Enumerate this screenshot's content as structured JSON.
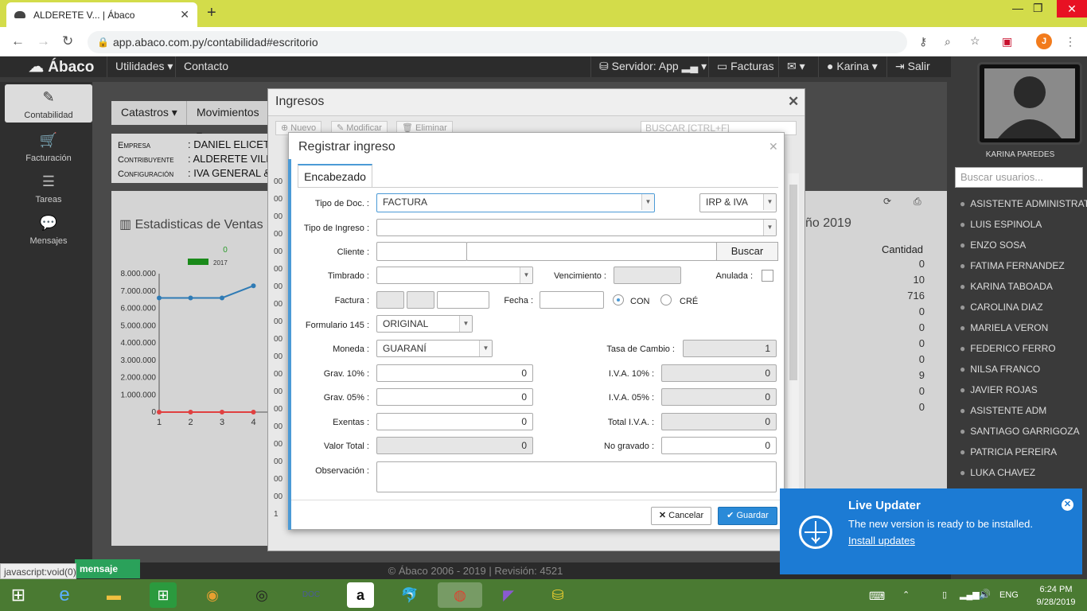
{
  "browser": {
    "tab_title": "ALDERETE V... | Ábaco",
    "url": "app.abaco.com.py/contabilidad#escritorio",
    "profile_initial": "J"
  },
  "app": {
    "brand": "Ábaco",
    "topnav": {
      "utilidades": "Utilidades",
      "contacto": "Contacto",
      "servidor": "Servidor: App",
      "facturas": "Facturas",
      "user": "Karina",
      "salir": "Salir"
    },
    "sidebar": [
      {
        "label": "Contabilidad",
        "icon": "paperclip-icon"
      },
      {
        "label": "Facturación",
        "icon": "cart-icon"
      },
      {
        "label": "Tareas",
        "icon": "tasks-icon"
      },
      {
        "label": "Mensajes",
        "icon": "comments-icon"
      }
    ],
    "menubar": {
      "catastros": "Catastros",
      "movimientos": "Movimientos"
    },
    "info": [
      {
        "key": "Empresa",
        "value": ": DANIEL ELICET"
      },
      {
        "key": "Contribuyente",
        "value": ": ALDERETE VILL"
      },
      {
        "key": "Configuración",
        "value": ": IVA GENERAL &"
      }
    ],
    "stats": {
      "title": "Estadisticas de Ventas",
      "title_right": "ño 2019",
      "legend_value": "0",
      "legend_year": "2017",
      "col_header": "Cantidad",
      "quantities": [
        "0",
        "10",
        "716",
        "0",
        "0",
        "0",
        "0",
        "9",
        "0",
        "0"
      ]
    },
    "footer": "© Ábaco 2006 - 2019 | Revisión: 4521",
    "status_url": "javascript:void(0)",
    "message_button": "mensaje"
  },
  "chart_data": {
    "type": "line",
    "title": "",
    "xlabel": "",
    "ylabel": "",
    "ylim": [
      0,
      8000000
    ],
    "x": [
      1,
      2,
      3,
      4
    ],
    "yticks": [
      "8.000.000",
      "7.000.000",
      "6.000.000",
      "5.000.000",
      "4.000.000",
      "3.000.000",
      "2.000.000",
      "1.000.000",
      "0"
    ],
    "series": [
      {
        "name": "2017",
        "color": "#2f7bb5",
        "values": [
          6600000,
          6600000,
          6600000,
          7300000
        ]
      },
      {
        "name": "",
        "color": "#e04040",
        "values": [
          0,
          0,
          0,
          0
        ]
      }
    ]
  },
  "users": {
    "current": "KARINA PAREDES",
    "search_placeholder": "Buscar usuarios...",
    "list": [
      "ASISTENTE ADMINISTRAT...",
      "LUIS ESPINOLA",
      "ENZO SOSA",
      "FATIMA FERNANDEZ",
      "KARINA TABOADA",
      "CAROLINA DIAZ",
      "MARIELA VERON",
      "FEDERICO FERRO",
      "NILSA FRANCO",
      "JAVIER ROJAS",
      "ASISTENTE ADM",
      "SANTIAGO GARRIGOZA",
      "PATRICIA PEREIRA",
      "LUKA CHAVEZ"
    ]
  },
  "ingresos": {
    "title": "Ingresos",
    "nuevo": "Nuevo",
    "modificar": "Modificar",
    "eliminar": "Eliminar",
    "search_placeholder": "BUSCAR [CTRL+F]",
    "rows": [
      "00",
      "00",
      "00",
      "00",
      "00",
      "00",
      "00",
      "00",
      "00",
      "00",
      "00",
      "00",
      "00",
      "00",
      "00",
      "00",
      "00",
      "00",
      "00",
      "1"
    ]
  },
  "registrar": {
    "title": "Registrar ingreso",
    "tab": "Encabezado",
    "tipo_doc_label": "Tipo de Doc. :",
    "tipo_doc": "FACTURA",
    "impuesto": "IRP & IVA",
    "tipo_ingreso_label": "Tipo de Ingreso :",
    "tipo_ingreso": "",
    "cliente_label": "Cliente :",
    "buscar": "Buscar",
    "timbrado_label": "Timbrado :",
    "vencimiento_label": "Vencimiento :",
    "anulada_label": "Anulada :",
    "factura_label": "Factura :",
    "fecha_label": "Fecha :",
    "con": "CON",
    "cre": "CRÉ",
    "formulario_label": "Formulario 145 :",
    "formulario": "ORIGINAL",
    "moneda_label": "Moneda :",
    "moneda": "GUARANÍ",
    "tasa_label": "Tasa de Cambio :",
    "tasa": "1",
    "grav10_label": "Grav. 10% :",
    "grav10": "0",
    "iva10_label": "I.V.A. 10% :",
    "iva10": "0",
    "grav05_label": "Grav. 05% :",
    "grav05": "0",
    "iva05_label": "I.V.A. 05% :",
    "iva05": "0",
    "exentas_label": "Exentas :",
    "exentas": "0",
    "total_iva_label": "Total I.V.A. :",
    "total_iva": "0",
    "valor_total_label": "Valor Total :",
    "valor_total": "0",
    "no_gravado_label": "No gravado :",
    "no_gravado": "0",
    "observacion_label": "Observación :",
    "cancelar": "Cancelar",
    "guardar": "Guardar"
  },
  "toast": {
    "title": "Live Updater",
    "message": "The new version is ready to be installed.",
    "link": "Install updates"
  },
  "tray": {
    "time": "6:24 PM",
    "date": "9/28/2019",
    "lang": "ENG"
  }
}
